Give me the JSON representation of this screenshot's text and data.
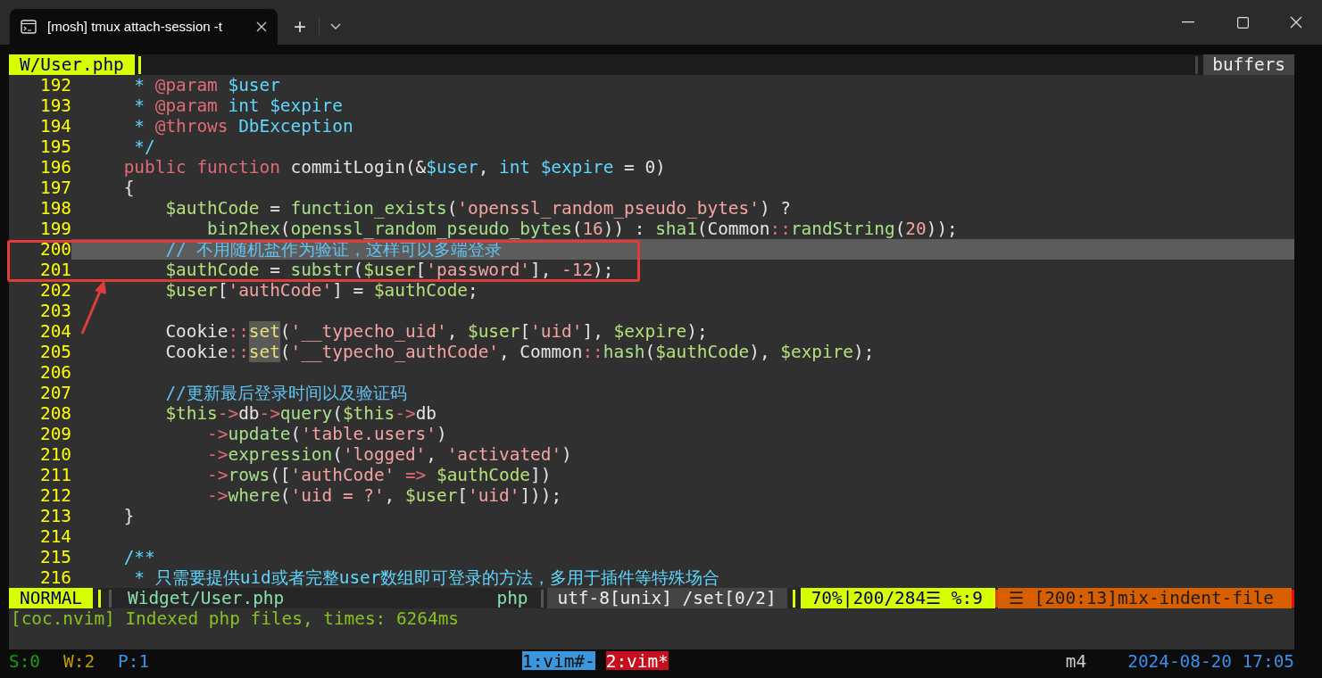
{
  "window": {
    "tab_title": "[mosh] tmux attach-session -t",
    "new_tab": "+"
  },
  "tabline": {
    "current_file": "W/User.php",
    "right_label": "buffers"
  },
  "lines": [
    {
      "number": "192",
      "current": false,
      "tokens": [
        {
          "kind": "doc",
          "text": "     * "
        },
        {
          "kind": "tag",
          "text": "@param"
        },
        {
          "kind": "doc",
          "text": " $user"
        }
      ]
    },
    {
      "number": "193",
      "current": false,
      "tokens": [
        {
          "kind": "doc",
          "text": "     * "
        },
        {
          "kind": "tag",
          "text": "@param"
        },
        {
          "kind": "doc",
          "text": " int $expire"
        }
      ]
    },
    {
      "number": "194",
      "current": false,
      "tokens": [
        {
          "kind": "doc",
          "text": "     * "
        },
        {
          "kind": "tag",
          "text": "@throws"
        },
        {
          "kind": "doc",
          "text": " DbException"
        }
      ]
    },
    {
      "number": "195",
      "current": false,
      "tokens": [
        {
          "kind": "doc",
          "text": "     */"
        }
      ]
    },
    {
      "number": "196",
      "current": false,
      "tokens": [
        {
          "kind": "kw",
          "text": "    public function"
        },
        {
          "kind": "plain",
          "text": " commitLogin(&"
        },
        {
          "kind": "doc",
          "text": "$user"
        },
        {
          "kind": "plain",
          "text": ", "
        },
        {
          "kind": "doc",
          "text": "int $expire"
        },
        {
          "kind": "plain",
          "text": " = 0)"
        }
      ]
    },
    {
      "number": "197",
      "current": false,
      "tokens": [
        {
          "kind": "plain",
          "text": "    {"
        }
      ]
    },
    {
      "number": "198",
      "current": false,
      "tokens": [
        {
          "kind": "var",
          "text": "        $authCode"
        },
        {
          "kind": "plain",
          "text": " = "
        },
        {
          "kind": "fn",
          "text": "function_exists"
        },
        {
          "kind": "plain",
          "text": "("
        },
        {
          "kind": "str",
          "text": "'openssl_random_pseudo_bytes'"
        },
        {
          "kind": "plain",
          "text": ") ?"
        }
      ]
    },
    {
      "number": "199",
      "current": false,
      "tokens": [
        {
          "kind": "fn",
          "text": "            bin2hex"
        },
        {
          "kind": "plain",
          "text": "("
        },
        {
          "kind": "fn",
          "text": "openssl_random_pseudo_bytes"
        },
        {
          "kind": "plain",
          "text": "("
        },
        {
          "kind": "str",
          "text": "16"
        },
        {
          "kind": "plain",
          "text": ")) : "
        },
        {
          "kind": "fn",
          "text": "sha1"
        },
        {
          "kind": "plain",
          "text": "(Common"
        },
        {
          "kind": "op",
          "text": "::"
        },
        {
          "kind": "fn",
          "text": "randString"
        },
        {
          "kind": "plain",
          "text": "("
        },
        {
          "kind": "str",
          "text": "20"
        },
        {
          "kind": "plain",
          "text": "));"
        }
      ]
    },
    {
      "number": "200",
      "current": true,
      "tokens": [
        {
          "kind": "cmt",
          "text": "        // 不用随机盐作为验证，这样可以多端登录"
        }
      ]
    },
    {
      "number": "201",
      "current": false,
      "tokens": [
        {
          "kind": "var",
          "text": "        $authCode"
        },
        {
          "kind": "plain",
          "text": " = "
        },
        {
          "kind": "fn",
          "text": "substr"
        },
        {
          "kind": "plain",
          "text": "("
        },
        {
          "kind": "var",
          "text": "$user"
        },
        {
          "kind": "plain",
          "text": "["
        },
        {
          "kind": "str",
          "text": "'password'"
        },
        {
          "kind": "plain",
          "text": "], "
        },
        {
          "kind": "str",
          "text": "-12"
        },
        {
          "kind": "plain",
          "text": ");"
        }
      ]
    },
    {
      "number": "202",
      "current": false,
      "tokens": [
        {
          "kind": "var",
          "text": "        $user"
        },
        {
          "kind": "plain",
          "text": "["
        },
        {
          "kind": "str",
          "text": "'authCode'"
        },
        {
          "kind": "plain",
          "text": "] = "
        },
        {
          "kind": "var",
          "text": "$authCode"
        },
        {
          "kind": "plain",
          "text": ";"
        }
      ]
    },
    {
      "number": "203",
      "current": false
    },
    {
      "number": "204",
      "current": false,
      "tokens": [
        {
          "kind": "plain",
          "text": "        Cookie"
        },
        {
          "kind": "op",
          "text": "::"
        },
        {
          "kind": "match",
          "text": "set"
        },
        {
          "kind": "plain",
          "text": "("
        },
        {
          "kind": "str",
          "text": "'__typecho_uid'"
        },
        {
          "kind": "plain",
          "text": ", "
        },
        {
          "kind": "var",
          "text": "$user"
        },
        {
          "kind": "plain",
          "text": "["
        },
        {
          "kind": "str",
          "text": "'uid'"
        },
        {
          "kind": "plain",
          "text": "], "
        },
        {
          "kind": "var",
          "text": "$expire"
        },
        {
          "kind": "plain",
          "text": ");"
        }
      ]
    },
    {
      "number": "205",
      "current": false,
      "tokens": [
        {
          "kind": "plain",
          "text": "        Cookie"
        },
        {
          "kind": "op",
          "text": "::"
        },
        {
          "kind": "match",
          "text": "set"
        },
        {
          "kind": "plain",
          "text": "("
        },
        {
          "kind": "str",
          "text": "'__typecho_authCode'"
        },
        {
          "kind": "plain",
          "text": ", Common"
        },
        {
          "kind": "op",
          "text": "::"
        },
        {
          "kind": "fn",
          "text": "hash"
        },
        {
          "kind": "plain",
          "text": "("
        },
        {
          "kind": "var",
          "text": "$authCode"
        },
        {
          "kind": "plain",
          "text": "), "
        },
        {
          "kind": "var",
          "text": "$expire"
        },
        {
          "kind": "plain",
          "text": ");"
        }
      ]
    },
    {
      "number": "206",
      "current": false
    },
    {
      "number": "207",
      "current": false,
      "tokens": [
        {
          "kind": "cmt",
          "text": "        //更新最后登录时间以及验证码"
        }
      ]
    },
    {
      "number": "208",
      "current": false,
      "tokens": [
        {
          "kind": "var",
          "text": "        $this"
        },
        {
          "kind": "op",
          "text": "->"
        },
        {
          "kind": "plain",
          "text": "db"
        },
        {
          "kind": "op",
          "text": "->"
        },
        {
          "kind": "fn",
          "text": "query"
        },
        {
          "kind": "plain",
          "text": "("
        },
        {
          "kind": "var",
          "text": "$this"
        },
        {
          "kind": "op",
          "text": "->"
        },
        {
          "kind": "plain",
          "text": "db"
        }
      ]
    },
    {
      "number": "209",
      "current": false,
      "tokens": [
        {
          "kind": "op",
          "text": "            ->"
        },
        {
          "kind": "fn",
          "text": "update"
        },
        {
          "kind": "plain",
          "text": "("
        },
        {
          "kind": "str",
          "text": "'table.users'"
        },
        {
          "kind": "plain",
          "text": ")"
        }
      ]
    },
    {
      "number": "210",
      "current": false,
      "tokens": [
        {
          "kind": "op",
          "text": "            ->"
        },
        {
          "kind": "fn",
          "text": "expression"
        },
        {
          "kind": "plain",
          "text": "("
        },
        {
          "kind": "str",
          "text": "'logged'"
        },
        {
          "kind": "plain",
          "text": ", "
        },
        {
          "kind": "str",
          "text": "'activated'"
        },
        {
          "kind": "plain",
          "text": ")"
        }
      ]
    },
    {
      "number": "211",
      "current": false,
      "tokens": [
        {
          "kind": "op",
          "text": "            ->"
        },
        {
          "kind": "fn",
          "text": "rows"
        },
        {
          "kind": "plain",
          "text": "(["
        },
        {
          "kind": "str",
          "text": "'authCode'"
        },
        {
          "kind": "op",
          "text": " => "
        },
        {
          "kind": "var",
          "text": "$authCode"
        },
        {
          "kind": "plain",
          "text": "])"
        }
      ]
    },
    {
      "number": "212",
      "current": false,
      "tokens": [
        {
          "kind": "op",
          "text": "            ->"
        },
        {
          "kind": "fn",
          "text": "where"
        },
        {
          "kind": "plain",
          "text": "("
        },
        {
          "kind": "str",
          "text": "'uid = ?'"
        },
        {
          "kind": "plain",
          "text": ", "
        },
        {
          "kind": "var",
          "text": "$user"
        },
        {
          "kind": "plain",
          "text": "["
        },
        {
          "kind": "str",
          "text": "'uid'"
        },
        {
          "kind": "plain",
          "text": "]));"
        }
      ]
    },
    {
      "number": "213",
      "current": false,
      "tokens": [
        {
          "kind": "plain",
          "text": "    }"
        }
      ]
    },
    {
      "number": "214",
      "current": false
    },
    {
      "number": "215",
      "current": false,
      "tokens": [
        {
          "kind": "doc",
          "text": "    /**"
        }
      ]
    },
    {
      "number": "216",
      "current": false,
      "tokens": [
        {
          "kind": "doc",
          "text": "     * 只需要提供uid或者完整user数组即可登录的方法，多用于插件等特殊场合"
        }
      ]
    }
  ],
  "status_line": {
    "mode": "NORMAL",
    "file": "Widget/User.php",
    "filetype": "php",
    "encoding": "utf-8[unix] /set[0/2]",
    "position": "70%|200/284☰ %:9",
    "warning": "☰ [200:13]mix-indent-file"
  },
  "message": "[coc.nvim] Indexed php files, times: 6264ms",
  "tmux": {
    "counters": [
      {
        "text": "S:0",
        "color": "#13a10e"
      },
      {
        "text": "W:2",
        "color": "#c19c00"
      },
      {
        "text": "P:1",
        "color": "#3b8eea"
      }
    ],
    "windows": [
      {
        "label": "1:vim#-",
        "selected": false
      },
      {
        "label": "2:vim*",
        "selected": true
      }
    ],
    "host": "m4",
    "datetime": "2024-08-20 17:05"
  }
}
